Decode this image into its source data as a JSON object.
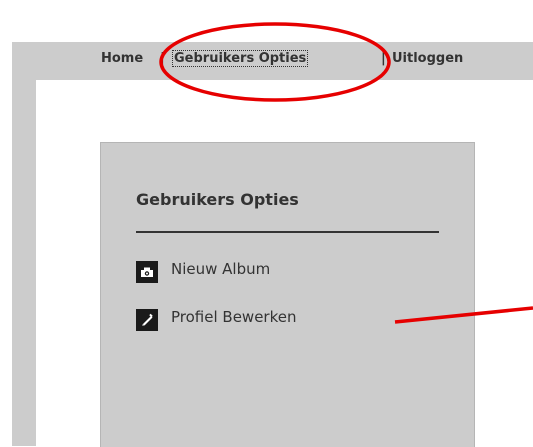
{
  "nav": {
    "home": "Home",
    "options": "Gebruikers Opties",
    "separator": "|",
    "logout": "Uitloggen"
  },
  "panel": {
    "title": "Gebruikers Opties",
    "items": [
      {
        "label": "Nieuw Album",
        "icon": "camera-icon"
      },
      {
        "label": "Profiel Bewerken",
        "icon": "pen-icon"
      }
    ]
  },
  "annotation": {
    "color": "#e60000"
  }
}
